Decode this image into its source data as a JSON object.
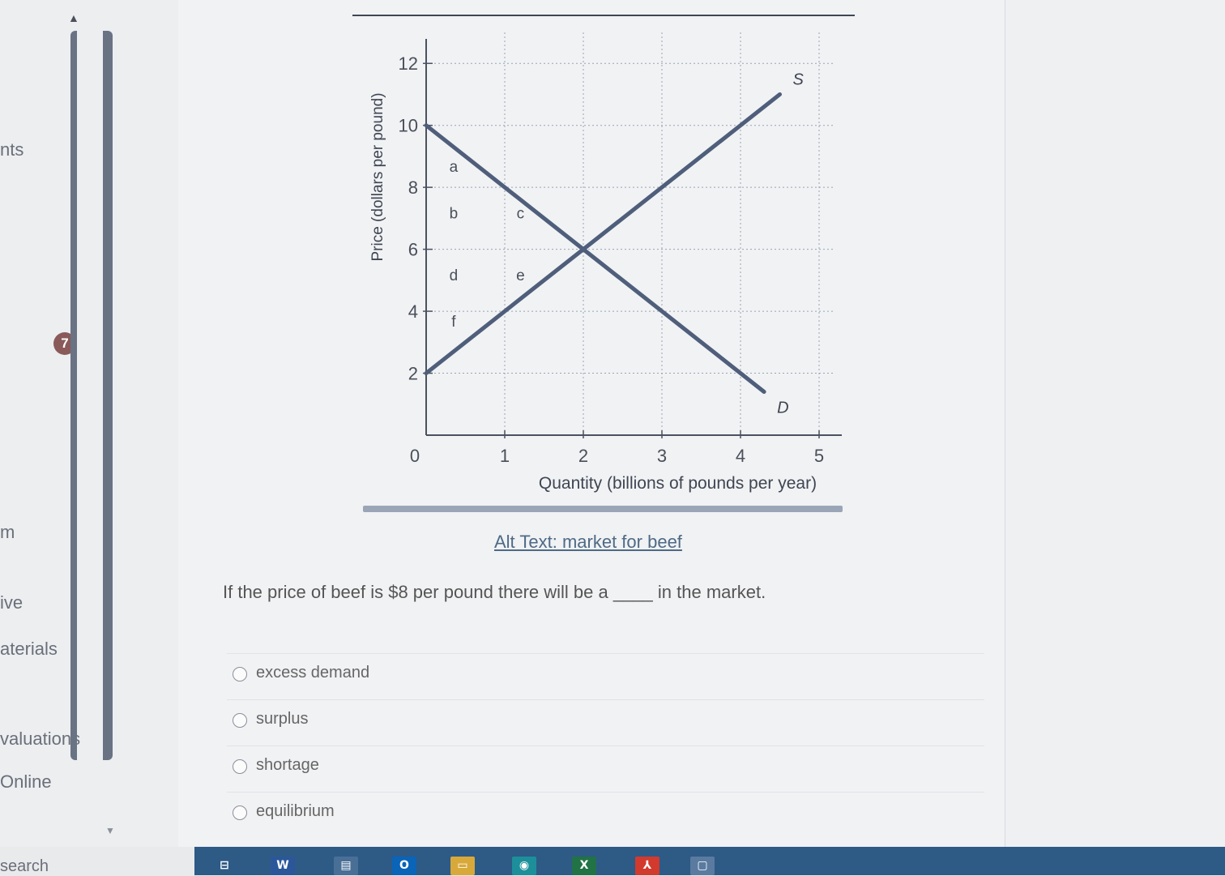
{
  "sidebar": {
    "items": [
      {
        "label": "nts"
      },
      {
        "label": "m"
      },
      {
        "label": "ive"
      },
      {
        "label": "aterials"
      },
      {
        "label": "valuations"
      },
      {
        "label": "Online"
      }
    ],
    "badge": "7",
    "search_label": "search"
  },
  "chart_data": {
    "type": "line",
    "xlabel": "Quantity (billions of pounds per year)",
    "ylabel": "Price (dollars per pound)",
    "xlim": [
      0,
      5
    ],
    "ylim": [
      0,
      13
    ],
    "x_ticks": [
      "0",
      "1",
      "2",
      "3",
      "4",
      "5"
    ],
    "y_ticks": [
      "2",
      "4",
      "6",
      "8",
      "10",
      "12"
    ],
    "grid": true,
    "series": [
      {
        "name": "S",
        "points": [
          [
            0,
            2
          ],
          [
            2,
            6
          ],
          [
            4.5,
            11
          ]
        ]
      },
      {
        "name": "D",
        "points": [
          [
            0,
            10
          ],
          [
            2,
            6
          ],
          [
            4.3,
            1.4
          ]
        ]
      }
    ],
    "region_labels": [
      {
        "text": "a",
        "x": 0.35,
        "y": 8.5
      },
      {
        "text": "b",
        "x": 0.35,
        "y": 7.0
      },
      {
        "text": "c",
        "x": 1.2,
        "y": 7.0
      },
      {
        "text": "d",
        "x": 0.35,
        "y": 5.0
      },
      {
        "text": "e",
        "x": 1.2,
        "y": 5.0
      },
      {
        "text": "f",
        "x": 0.35,
        "y": 3.5
      }
    ]
  },
  "main": {
    "alt_text": "Alt Text: market for beef",
    "question": "If the price of beef is $8 per pound there will be a ____ in the market.",
    "options": [
      {
        "label": "excess demand"
      },
      {
        "label": "surplus"
      },
      {
        "label": "shortage"
      },
      {
        "label": "equilibrium"
      }
    ]
  },
  "taskbar": {
    "icons": [
      {
        "name": "task-view-icon",
        "glyph": "⊟",
        "color": "#2e5a86"
      },
      {
        "name": "word-icon",
        "glyph": "W",
        "color": "#2b579a"
      },
      {
        "name": "notepad-icon",
        "glyph": "▤",
        "color": "#4a6f96"
      },
      {
        "name": "outlook-icon",
        "glyph": "O",
        "color": "#0a64b8"
      },
      {
        "name": "file-explorer-icon",
        "glyph": "▭",
        "color": "#d8a93a"
      },
      {
        "name": "edge-icon",
        "glyph": "◉",
        "color": "#1d8f9a"
      },
      {
        "name": "excel-icon",
        "glyph": "X",
        "color": "#217346"
      },
      {
        "name": "acrobat-icon",
        "glyph": "⅄",
        "color": "#d23a2e"
      },
      {
        "name": "app-window-icon",
        "glyph": "▢",
        "color": "#5a7aa0"
      }
    ]
  }
}
